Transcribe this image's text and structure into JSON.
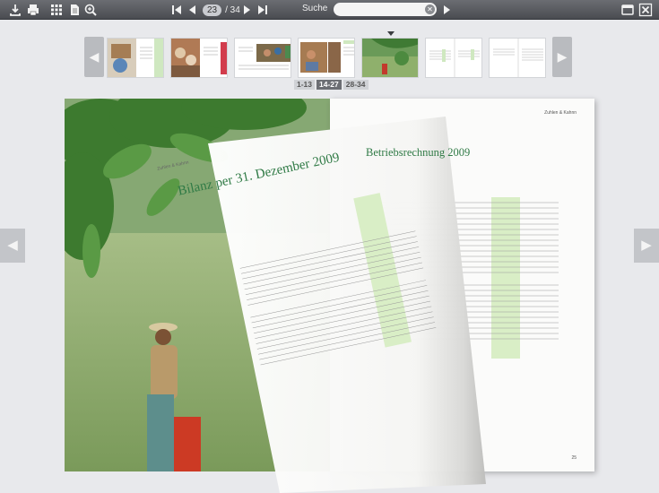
{
  "toolbar": {
    "page_current": "23",
    "page_total": "/ 34",
    "search_label": "Suche",
    "search_placeholder": ""
  },
  "strip": {
    "ranges": [
      "1-13",
      "14-27",
      "28-34"
    ],
    "active_range": "14-27"
  },
  "book": {
    "left_title": "Bilanz per 31. Dezember 2009",
    "right_title": "Betriebsrechnung 2009",
    "right_header": "Zuhlen & Kahnn",
    "left_header": "Zuhlen & Kahnn",
    "page_number": "25"
  },
  "colors": {
    "accent_green": "#2f7a45",
    "toolbar": "#55575c",
    "highlight": "#d9eec6"
  },
  "icons": [
    "download-icon",
    "print-icon",
    "grid-icon",
    "page-icon",
    "zoom-icon",
    "first-page-icon",
    "prev-page-icon",
    "next-page-icon",
    "last-page-icon",
    "search-go-icon",
    "window-icon",
    "close-icon"
  ]
}
